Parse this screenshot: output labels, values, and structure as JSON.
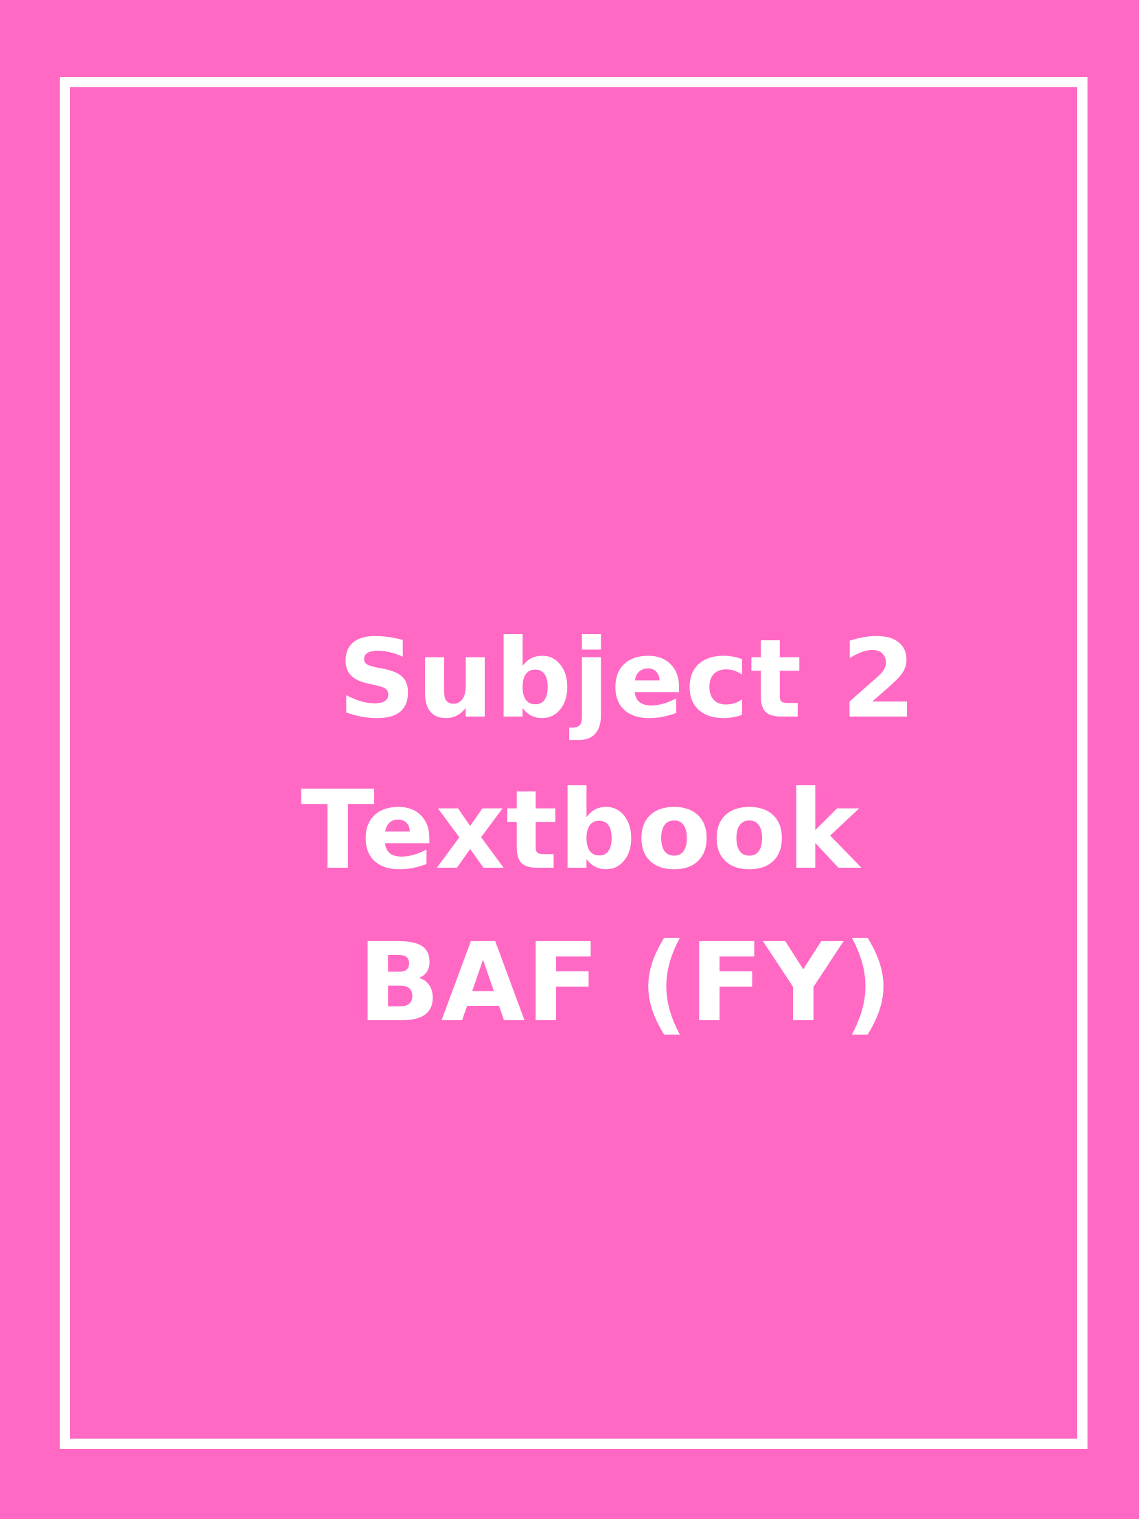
{
  "cover": {
    "background_color": "#ff69c4",
    "border_color": "#ffffff",
    "text_color": "#ffffff",
    "lines": [
      "Subject 2",
      "Textbook",
      "BAF (FY)"
    ]
  }
}
